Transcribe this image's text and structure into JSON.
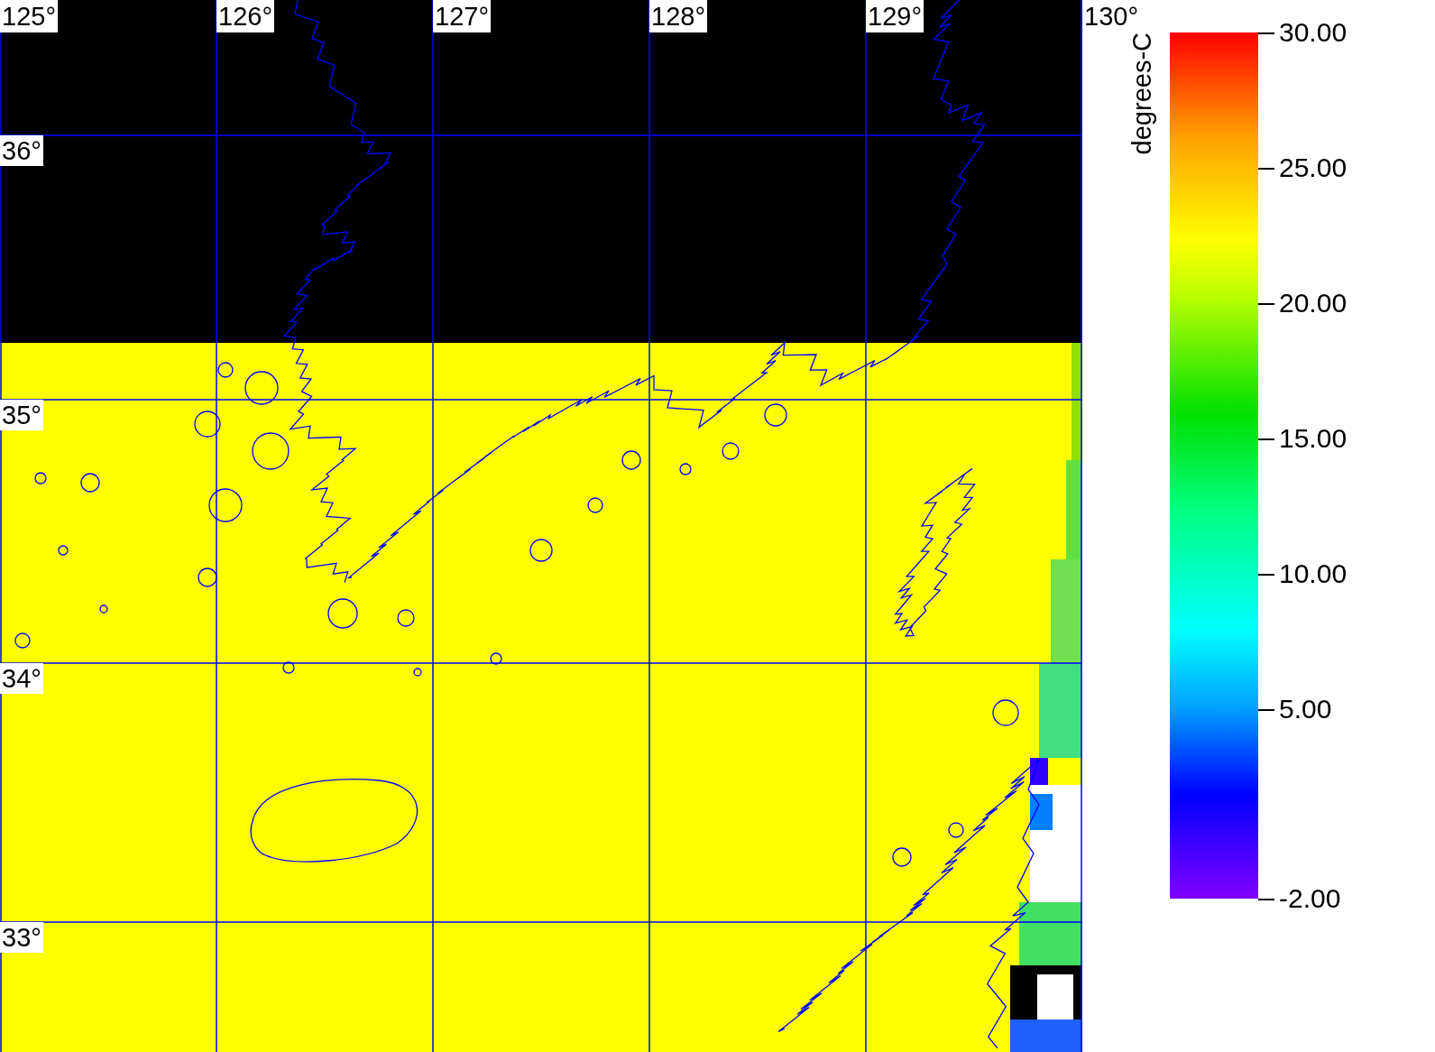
{
  "map": {
    "lon_labels": [
      "125°",
      "126°",
      "127°",
      "128°",
      "129°",
      "130°"
    ],
    "lat_labels": [
      "36°",
      "35°",
      "34°",
      "33°"
    ]
  },
  "colorbar": {
    "title": "degrees-C",
    "tick_labels": [
      "30.00",
      "25.00",
      "20.00",
      "15.00",
      "10.00",
      "5.00",
      "-2.00"
    ]
  }
}
